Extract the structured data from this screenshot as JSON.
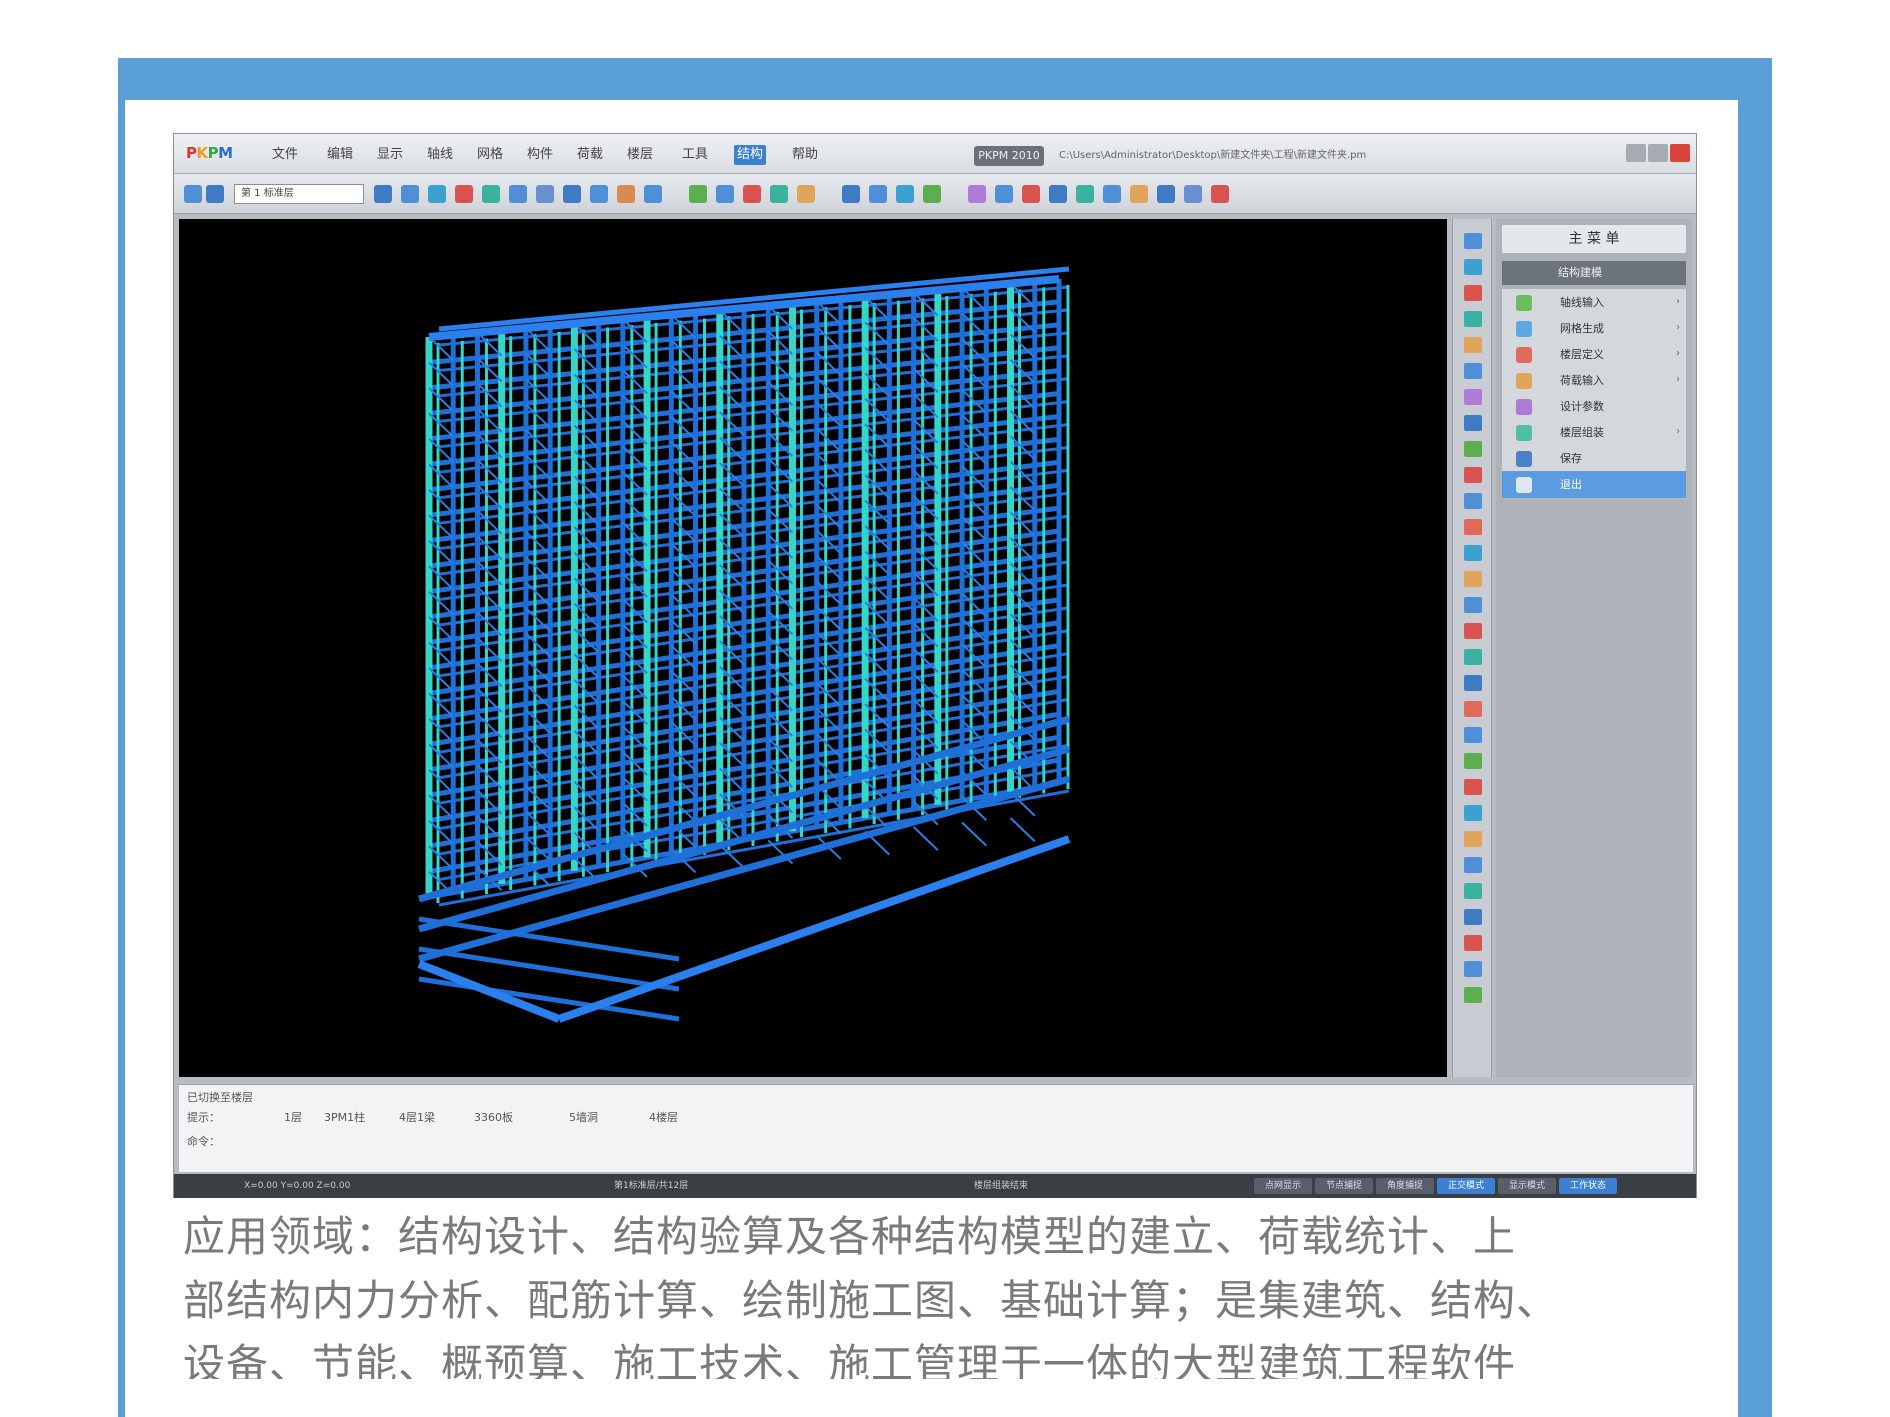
{
  "app": {
    "logo_text": "PKPM",
    "menu": [
      "文件",
      "编辑",
      "显示",
      "轴线",
      "网格",
      "构件",
      "荷载",
      "楼层",
      "工具",
      "结构",
      "帮助"
    ],
    "active_menu_index": 9,
    "version_tag": "PKPM 2010",
    "file_path": "C:\\Users\\Administrator\\Desktop\\新建文件夹\\工程\\新建文件夹.pm",
    "toolbar_select": "第 1 标准层",
    "right_panel": {
      "title": "主 菜 单",
      "header": "结构建模",
      "items": [
        {
          "label": "轴线输入",
          "has_arrow": true,
          "icon_color": "#6dbb5a"
        },
        {
          "label": "网格生成",
          "has_arrow": true,
          "icon_color": "#5aa9e0"
        },
        {
          "label": "楼层定义",
          "has_arrow": true,
          "icon_color": "#e06a5a"
        },
        {
          "label": "荷载输入",
          "has_arrow": true,
          "icon_color": "#e0a55a"
        },
        {
          "label": "设计参数",
          "has_arrow": false,
          "icon_color": "#b07ad8"
        },
        {
          "label": "楼层组装",
          "has_arrow": true,
          "icon_color": "#4fc0a6"
        },
        {
          "label": "保存",
          "has_arrow": false,
          "icon_color": "#4a80c8"
        },
        {
          "label": "退出",
          "has_arrow": false,
          "icon_color": "#e0e6ee",
          "selected": true
        }
      ]
    },
    "command": {
      "line1": "已切换至楼层",
      "line2_prefix": "提示：",
      "options": [
        "1层",
        "3PM1柱",
        "4层1梁",
        "3360板",
        "5墙洞",
        "4楼层"
      ],
      "line3": "命令："
    },
    "status": {
      "segments": [
        "X=0.00  Y=0.00  Z=0.00",
        "第1标准层/共12层",
        "楼层组装结束"
      ],
      "buttons": [
        "点网显示",
        "节点捕捉",
        "角度捕捉",
        "正交模式",
        "显示模式",
        "工作状态"
      ],
      "active_buttons": [
        3,
        5
      ]
    }
  },
  "colors": {
    "frame_blue": "#5a9fd6",
    "structure_blue": "#1f6fd8",
    "structure_cyan": "#35d6c8",
    "viewport_bg": "#000000"
  },
  "caption": {
    "line1": "应用领域：结构设计、结构验算及各种结构模型的建立、荷载统计、上",
    "line2": "部结构内力分析、配筋计算、绘制施工图、基础计算；是集建筑、结构、",
    "line3": "设备、节能、概预算、施工技术、施工管理于一体的大型建筑工程软件"
  }
}
